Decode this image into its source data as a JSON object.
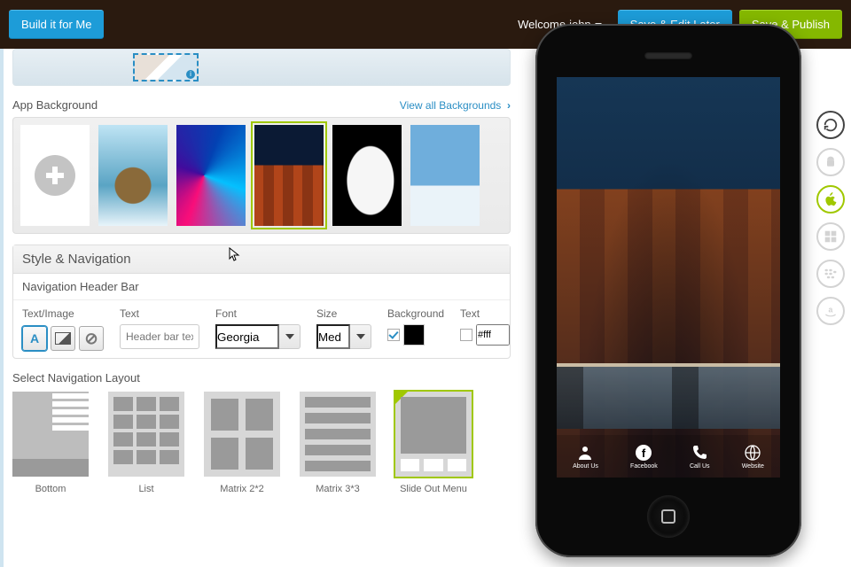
{
  "topbar": {
    "build_label": "Build it for Me",
    "welcome_prefix": "Welcome",
    "username": "john",
    "save_later": "Save & Edit Later",
    "save_publish": "Save & Publish"
  },
  "app_background": {
    "title": "App Background",
    "view_all": "View all Backgrounds",
    "tiles": [
      "add",
      "ufo",
      "neon",
      "city",
      "face",
      "clouds"
    ],
    "selected_index": 3
  },
  "style_nav": {
    "title": "Style & Navigation",
    "subtitle": "Navigation Header Bar",
    "text_image_label": "Text/Image",
    "text_label": "Text",
    "text_placeholder": "Header bar text",
    "font_label": "Font",
    "font_value": "Georgia",
    "size_label": "Size",
    "size_value": "Med",
    "background_label": "Background",
    "background_checked": true,
    "background_color": "#000000",
    "textcolor_label": "Text",
    "textcolor_checked": false,
    "textcolor_value": "#fff"
  },
  "nav_layout": {
    "title": "Select Navigation Layout",
    "items": [
      {
        "key": "bottom",
        "label": "Bottom"
      },
      {
        "key": "list",
        "label": "List"
      },
      {
        "key": "m22",
        "label": "Matrix 2*2"
      },
      {
        "key": "m33",
        "label": "Matrix 3*3"
      },
      {
        "key": "slide",
        "label": "Slide Out Menu"
      }
    ],
    "selected_key": "slide"
  },
  "phone": {
    "tabs": [
      {
        "icon": "person",
        "label": "About Us"
      },
      {
        "icon": "facebook",
        "label": "Facebook"
      },
      {
        "icon": "phone",
        "label": "Call Us"
      },
      {
        "icon": "globe",
        "label": "Website"
      }
    ]
  },
  "device_switcher": {
    "items": [
      "refresh",
      "android",
      "apple",
      "windows",
      "blackberry",
      "amazon"
    ],
    "active": "apple"
  }
}
